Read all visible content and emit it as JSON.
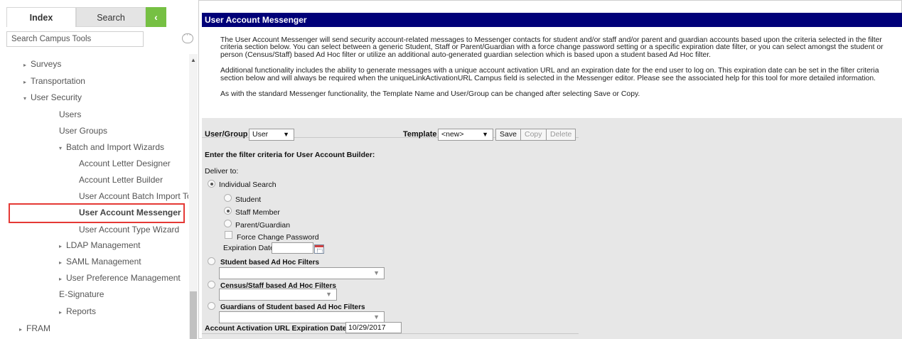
{
  "tabs": {
    "index": "Index",
    "search": "Search",
    "collapse": "‹"
  },
  "search": {
    "placeholder": "Search Campus Tools"
  },
  "tree": [
    {
      "label": "Surveys",
      "arrow": "▸"
    },
    {
      "label": "Transportation",
      "arrow": "▸"
    },
    {
      "label": "User Security",
      "arrow": "▾"
    },
    {
      "label": "Users",
      "arrow": ""
    },
    {
      "label": "User Groups",
      "arrow": ""
    },
    {
      "label": "Batch and Import Wizards",
      "arrow": "▾"
    },
    {
      "label": "Account Letter Designer",
      "arrow": ""
    },
    {
      "label": "Account Letter Builder",
      "arrow": ""
    },
    {
      "label": "User Account Batch Import Too",
      "arrow": ""
    },
    {
      "label": "User Account Messenger",
      "arrow": ""
    },
    {
      "label": "User Account Type Wizard",
      "arrow": ""
    },
    {
      "label": "LDAP Management",
      "arrow": "▸"
    },
    {
      "label": "SAML Management",
      "arrow": "▸"
    },
    {
      "label": "User Preference Management",
      "arrow": "▸"
    },
    {
      "label": "E-Signature",
      "arrow": ""
    },
    {
      "label": "Reports",
      "arrow": "▸"
    },
    {
      "label": "FRAM",
      "arrow": "▸"
    }
  ],
  "page": {
    "title": "User Account Messenger",
    "desc1": "The User Account Messenger will send security account-related messages to Messenger contacts for student and/or staff and/or parent and guardian accounts based upon the criteria selected in the filter criteria section below. You can select between a generic Student, Staff or Parent/Guardian with a force change password setting or a specific expiration date filter, or you can select amongst the student or person (Census/Staff) based Ad Hoc filter or utilize an additional auto-generated guardian selection which is based upon a student based Ad Hoc filter.",
    "desc2": "Additional functionality includes the ability to generate messages with a unique account activation URL and an expiration date for the end user to log on. This expiration date can be set in the filter criteria section below and will always be required when the uniqueLinkActivationURL Campus field is selected in the Messenger editor. Please see the associated help for this tool for more detailed information.",
    "desc3": "As with the standard Messenger functionality, the Template Name and User/Group can be changed after selecting Save or Copy."
  },
  "form": {
    "user_group_label": "User/Group",
    "user_group_value": "User",
    "template_label": "Template",
    "template_value": "<new>",
    "save": "Save",
    "copy": "Copy",
    "delete": "Delete",
    "filter_heading": "Enter the filter criteria for User Account Builder:",
    "deliver_to": "Deliver to:",
    "individual_search": "Individual Search",
    "student": "Student",
    "staff_member": "Staff Member",
    "parent_guardian": "Parent/Guardian",
    "force_change_password": "Force Change Password",
    "expiration_date": "Expiration Date",
    "student_adhoc": "Student based Ad Hoc Filters",
    "census_adhoc": "Census/Staff based Ad Hoc Filters",
    "guardians_adhoc": "Guardians of Student based Ad Hoc Filters",
    "activation_label": "Account Activation URL Expiration Date:",
    "activation_value": "10/29/2017"
  },
  "colors": {
    "title_bar": "#000078",
    "collapse_tab": "#76c043",
    "highlight": "#e53935"
  }
}
